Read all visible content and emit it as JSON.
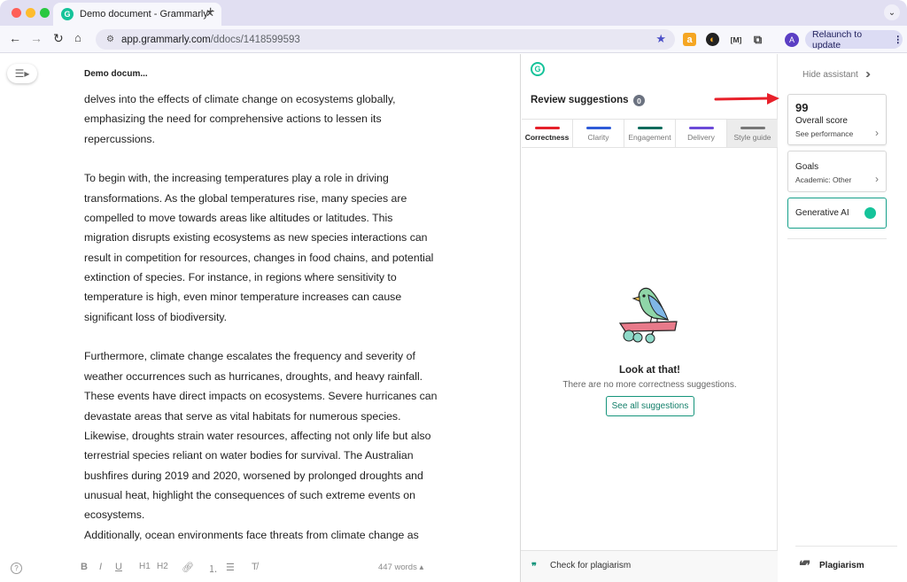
{
  "browser": {
    "tab_title": "Demo document - Grammarly",
    "tab_icon": "G",
    "new_tab": "+",
    "url_domain": "app.grammarly.com",
    "url_path": "/ddocs/1418599593",
    "relaunch_label": "Relaunch to update",
    "avatar_letter": "A",
    "ext_amazon": "a",
    "ext_m": "[M]"
  },
  "editor": {
    "doc_title": "Demo docum...",
    "paragraphs": [
      [
        "delves into the effects of climate change on ecosystems globally,",
        "emphasizing the need for comprehensive actions to lessen its",
        "repercussions."
      ],
      [
        "To begin with, the increasing temperatures play a role in driving",
        "transformations. As the global temperatures rise, many species are",
        "compelled to move towards areas like altitudes or latitudes. This",
        "migration disrupts existing ecosystems as new species interactions can",
        "result in competition for resources, changes in food chains, and potential",
        "extinction of species. For instance, in regions where sensitivity to",
        "temperature is high, even minor temperature increases can cause",
        "significant loss of biodiversity."
      ],
      [
        "Furthermore, climate change escalates the frequency and severity of",
        "weather occurrences such as hurricanes, droughts, and heavy rainfall.",
        "These events have direct impacts on ecosystems. Severe hurricanes can",
        "devastate areas that serve as vital habitats for numerous species.",
        "Likewise, droughts strain water resources, affecting not only life but also",
        "terrestrial species reliant on water bodies for survival. The Australian",
        "bushfires during 2019 and 2020, worsened by prolonged droughts and",
        "unusual heat, highlight the consequences of such extreme events on",
        "ecosystems."
      ],
      [
        "Additionally, ocean environments face threats from climate change as"
      ]
    ],
    "word_count": "447 words",
    "format_labels": {
      "bold": "B",
      "italic": "I",
      "underline": "U",
      "h1": "H1",
      "h2": "H2"
    }
  },
  "review": {
    "title": "Review suggestions",
    "count": "0",
    "tabs": [
      {
        "label": "Correctness",
        "color": "#e5202a"
      },
      {
        "label": "Clarity",
        "color": "#2e5bd8"
      },
      {
        "label": "Engagement",
        "color": "#0b6b5c"
      },
      {
        "label": "Delivery",
        "color": "#6b49d8"
      },
      {
        "label": "Style guide",
        "color": "#777777"
      }
    ],
    "empty_heading": "Look at that!",
    "empty_sub": "There are no more correctness suggestions.",
    "see_all": "See all suggestions",
    "plagiarism_check": "Check for plagiarism"
  },
  "assistant": {
    "hide_label": "Hide assistant",
    "score": "99",
    "score_label": "Overall score",
    "see_performance": "See performance",
    "goals_label": "Goals",
    "goals_value": "Academic: Other",
    "generative_ai": "Generative AI",
    "plagiarism": "Plagiarism"
  },
  "colors": {
    "accent": "#15c39a",
    "annotation_arrow": "#e8202a"
  }
}
